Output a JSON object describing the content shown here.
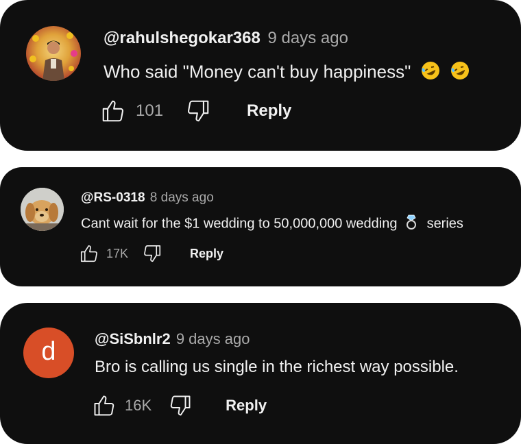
{
  "comments": [
    {
      "handle": "@rahulshegokar368",
      "time": "9 days ago",
      "text": "Who said \"Money can't buy happiness\"",
      "emojis": [
        "rofl-emoji",
        "rofl-emoji"
      ],
      "likes": "101",
      "reply_label": "Reply",
      "avatar": "photo"
    },
    {
      "handle": "@RS-0318",
      "time": "8 days ago",
      "text_before": "Cant wait for the $1 wedding to 50,000,000 wedding",
      "emoji": "ring-emoji",
      "text_after": "series",
      "likes": "17K",
      "reply_label": "Reply",
      "avatar": "dog-photo"
    },
    {
      "handle": "@SiSbnlr2",
      "time": "9 days ago",
      "text": "Bro is calling us single in the richest way possible.",
      "likes": "16K",
      "reply_label": "Reply",
      "avatar_letter": "d",
      "avatar_color": "#d84e27"
    }
  ],
  "colors": {
    "card_bg": "#0f0f0f",
    "primary_text": "#f1f1f1",
    "secondary_text": "#aaaaaa"
  }
}
